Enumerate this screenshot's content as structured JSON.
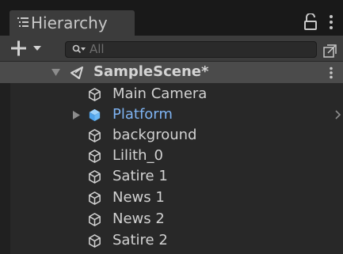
{
  "tab": {
    "title": "Hierarchy",
    "icon": "hierarchy-list-icon"
  },
  "toolbar": {
    "add_icon": "plus-icon",
    "dropdown_icon": "caret-down-icon",
    "search_placeholder": "All",
    "search_value": "",
    "search_icon": "search-filter-icon",
    "popout_icon": "popout-icon"
  },
  "scene": {
    "name": "SampleScene*",
    "icon": "unity-scene-icon",
    "expanded": true
  },
  "objects": [
    {
      "label": "Main Camera",
      "icon": "gameobject-cube-icon",
      "prefab": false,
      "has_children": false
    },
    {
      "label": "Platform",
      "icon": "prefab-cube-icon",
      "prefab": true,
      "has_children": true
    },
    {
      "label": "background",
      "icon": "gameobject-cube-icon",
      "prefab": false,
      "has_children": false
    },
    {
      "label": "Lilith_0",
      "icon": "gameobject-cube-icon",
      "prefab": false,
      "has_children": false
    },
    {
      "label": "Satire 1",
      "icon": "gameobject-cube-icon",
      "prefab": false,
      "has_children": false
    },
    {
      "label": "News 1",
      "icon": "gameobject-cube-icon",
      "prefab": false,
      "has_children": false
    },
    {
      "label": "News 2",
      "icon": "gameobject-cube-icon",
      "prefab": false,
      "has_children": false
    },
    {
      "label": "Satire 2",
      "icon": "gameobject-cube-icon",
      "prefab": false,
      "has_children": false
    }
  ],
  "colors": {
    "panel_background": "#282828",
    "tab_bar": "#191919",
    "tab_active": "#3c3c3c",
    "scene_header": "#4b4b4b",
    "text": "#d2d2d2",
    "prefab_text": "#7fb4f3",
    "prefab_icon": "#6ab7f5"
  }
}
